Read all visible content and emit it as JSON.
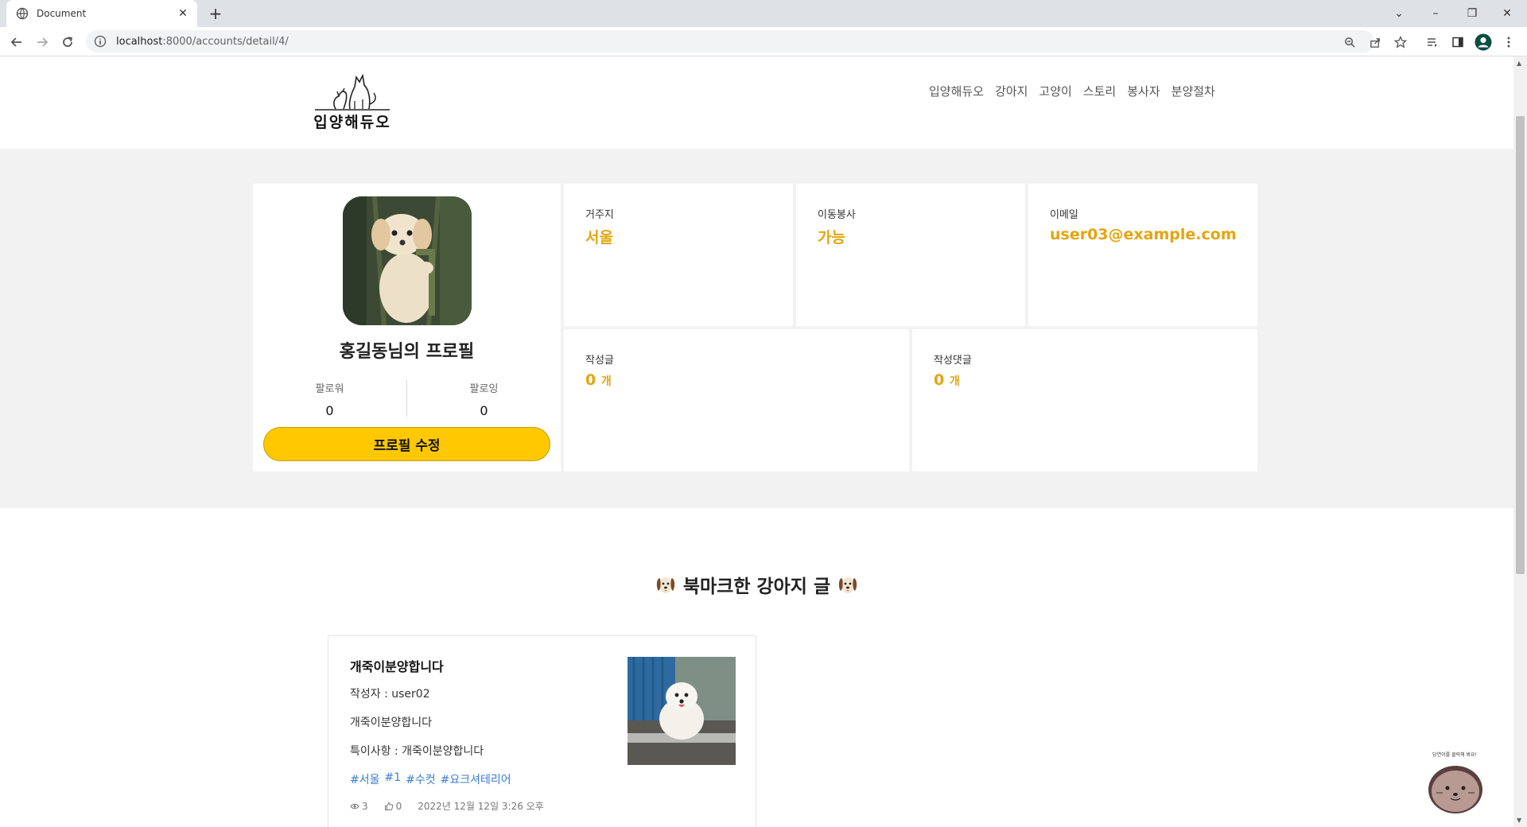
{
  "browser": {
    "tab_title": "Document",
    "url_host": "localhost",
    "url_path": ":8000/accounts/detail/4/"
  },
  "header": {
    "logo_text": "입양해듀오",
    "nav": [
      "입양해듀오",
      "강아지",
      "고양이",
      "스토리",
      "봉사자",
      "분양절차"
    ]
  },
  "profile": {
    "name": "홍길동님의 프로필",
    "followers_label": "팔로워",
    "followers_count": "0",
    "following_label": "팔로잉",
    "following_count": "0",
    "edit_button": "프로필 수정"
  },
  "stats": {
    "residence_label": "거주지",
    "residence_value": "서울",
    "transport_label": "이동봉사",
    "transport_value": "가능",
    "email_label": "이메일",
    "email_value": "user03@example.com",
    "posts_label": "작성글",
    "posts_count": "0",
    "posts_unit": "개",
    "comments_label": "작성댓글",
    "comments_count": "0",
    "comments_unit": "개"
  },
  "bookmarks": {
    "title": "북마크한 강아지 글",
    "posts": [
      {
        "title": "개죽이분양합니다",
        "author": "작성자 : user02",
        "body": "개죽이분양합니다",
        "note": "특이사항 : 개죽이분양합니다",
        "tags": [
          "#서울",
          "#1",
          "#수컷",
          "#요크셔테리어"
        ],
        "views": "3",
        "likes": "0",
        "date": "2022년 12월 12일 3:26 오후"
      }
    ]
  },
  "chat_widget": {
    "label": "당연이를 클릭해 봐요!"
  },
  "colors": {
    "accent_yellow": "#ffc800",
    "stat_value": "#e4a50e",
    "tag_blue": "#3a7bd5",
    "band_gray": "#f2f2f2"
  },
  "icons": [
    "globe-icon",
    "close-icon",
    "plus-icon",
    "back-icon",
    "forward-icon",
    "reload-icon",
    "info-icon",
    "zoom-icon",
    "share-icon",
    "star-icon",
    "reading-list-icon",
    "side-panel-icon",
    "profile-icon",
    "menu-icon",
    "eye-icon",
    "thumbs-up-icon",
    "dog-emoji-icon"
  ]
}
